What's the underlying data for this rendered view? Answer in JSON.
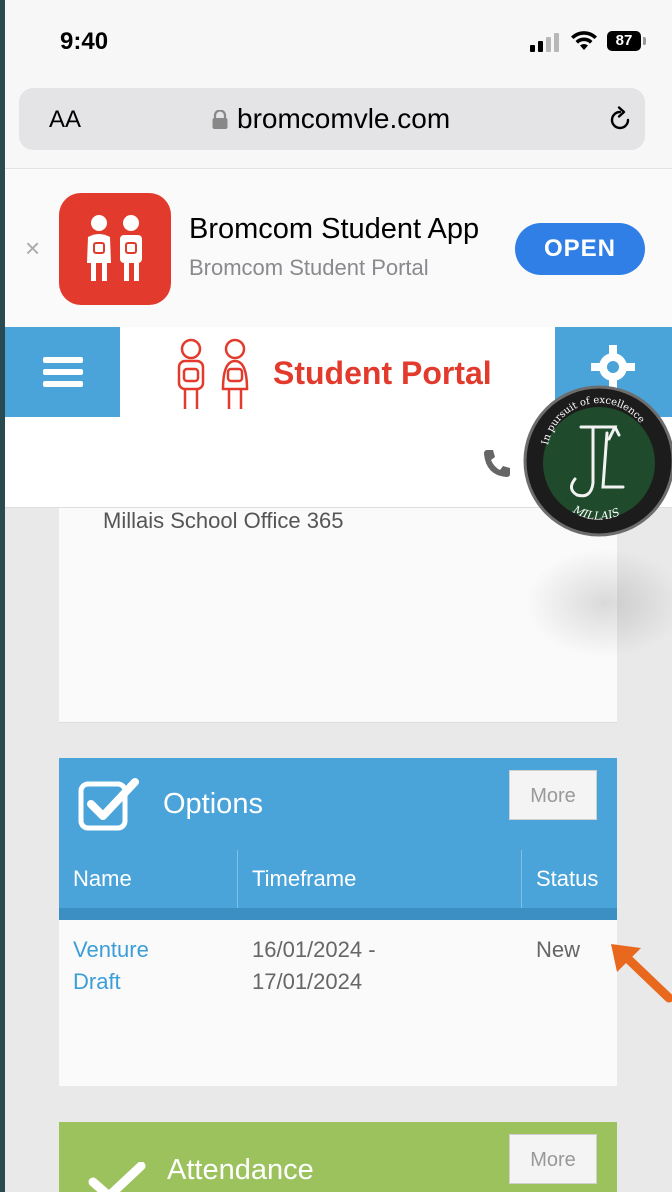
{
  "status_bar": {
    "time": "9:40",
    "battery": "87"
  },
  "browser": {
    "text_size_label": "AA",
    "url": "bromcomvle.com"
  },
  "smart_banner": {
    "app_name": "Bromcom Student App",
    "app_subtitle": "Bromcom Student Portal",
    "open_label": "OPEN",
    "close_glyph": "×"
  },
  "portal": {
    "title": "Student Portal"
  },
  "crest": {
    "motto": "In pursuit of excellence",
    "school": "MILLAIS"
  },
  "links_card": {
    "text": "Millais School Office 365"
  },
  "options": {
    "title": "Options",
    "more_label": "More",
    "columns": [
      "Name",
      "Timeframe",
      "Status"
    ],
    "rows": [
      {
        "name_line1": "Venture",
        "name_line2": "Draft",
        "time_line1": "16/01/2024 -",
        "time_line2": "17/01/2024",
        "status": "New"
      }
    ]
  },
  "attendance": {
    "title": "Attendance",
    "more_label": "More"
  },
  "colors": {
    "portal_blue": "#4aa3d9",
    "brand_red": "#e23a2c",
    "attendance_green": "#9cc25e",
    "ios_blue": "#2f7fe6",
    "arrow_orange": "#e8691e"
  }
}
